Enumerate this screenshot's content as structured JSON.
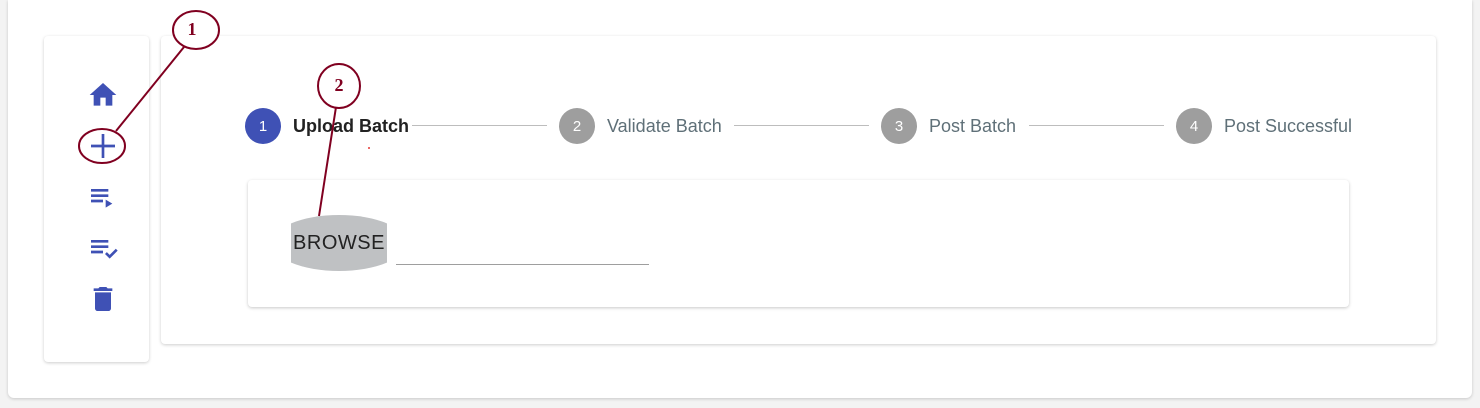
{
  "sidebar": {
    "items": [
      {
        "name": "home",
        "icon": "home-icon"
      },
      {
        "name": "add",
        "icon": "add-icon"
      },
      {
        "name": "playlist-play",
        "icon": "playlist-play-icon"
      },
      {
        "name": "playlist-check",
        "icon": "playlist-check-icon"
      },
      {
        "name": "delete",
        "icon": "delete-icon"
      }
    ],
    "icon_color": "#3f51b5"
  },
  "stepper": {
    "steps": [
      {
        "number": "1",
        "label": "Upload Batch",
        "active": true
      },
      {
        "number": "2",
        "label": "Validate Batch",
        "active": false
      },
      {
        "number": "3",
        "label": "Post Batch",
        "active": false
      },
      {
        "number": "4",
        "label": "Post Successful",
        "active": false
      }
    ],
    "active_color": "#3f51b5",
    "inactive_color": "#9e9e9e"
  },
  "upload": {
    "browse_label": "BROWSE",
    "file_value": ""
  },
  "annotations": [
    {
      "number": "1"
    },
    {
      "number": "2"
    }
  ],
  "annotation_color": "#800020"
}
